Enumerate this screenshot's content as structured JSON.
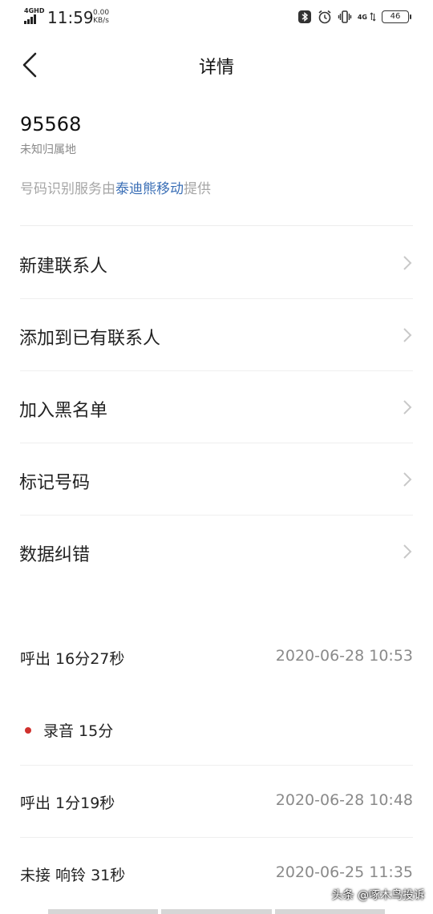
{
  "status_bar": {
    "network": "4GHD",
    "time": "11:59",
    "speed_value": "0.00",
    "speed_unit": "KB/s",
    "net_type": "4G",
    "battery": "46",
    "icons": [
      "signal-icon",
      "bluetooth-icon",
      "alarm-icon",
      "vibrate-icon",
      "battery-icon"
    ]
  },
  "header": {
    "title": "详情",
    "back_icon": "chevron-left-icon"
  },
  "contact": {
    "number": "95568",
    "location": "未知归属地",
    "provider_prefix": "号码识别服务由",
    "provider_link": "泰迪熊移动",
    "provider_suffix": "提供"
  },
  "menu": [
    {
      "label": "新建联系人"
    },
    {
      "label": "添加到已有联系人"
    },
    {
      "label": "加入黑名单"
    },
    {
      "label": "标记号码"
    },
    {
      "label": "数据纠错"
    }
  ],
  "calls": [
    {
      "type": "call",
      "text": "呼出 16分27秒",
      "time": "2020-06-28 10:53"
    },
    {
      "type": "recording",
      "text": "录音 15分",
      "time": ""
    },
    {
      "type": "call",
      "text": "呼出 1分19秒",
      "time": "2020-06-28 10:48"
    },
    {
      "type": "call",
      "text": "未接 响铃 31秒",
      "time": "2020-06-25 11:35"
    }
  ],
  "watermark": "头条 @啄木鸟投诉",
  "colors": {
    "link": "#3b6fb6",
    "record_dot": "#d0312d",
    "secondary_text": "#8a8a8a"
  }
}
